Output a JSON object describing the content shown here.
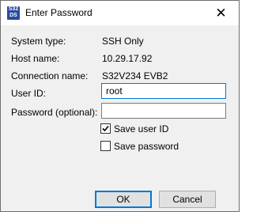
{
  "window": {
    "title": "Enter Password",
    "icon_text_top": "S32",
    "icon_text_bottom": "DS",
    "close_glyph": "✕"
  },
  "info": {
    "system_type_label": "System type:",
    "system_type_value": "SSH Only",
    "host_name_label": "Host name:",
    "host_name_value": "10.29.17.92",
    "connection_name_label": "Connection name:",
    "connection_name_value": "S32V234 EVB2"
  },
  "form": {
    "user_id_label": "User ID:",
    "user_id_value": "root",
    "password_label": "Password (optional):",
    "password_value": ""
  },
  "options": {
    "save_user_id_label": "Save user ID",
    "save_user_id_checked": true,
    "save_password_label": "Save password",
    "save_password_checked": false
  },
  "buttons": {
    "ok_label": "OK",
    "cancel_label": "Cancel"
  },
  "colors": {
    "accent": "#0078d7",
    "icon_bg": "#2a4a9e"
  }
}
